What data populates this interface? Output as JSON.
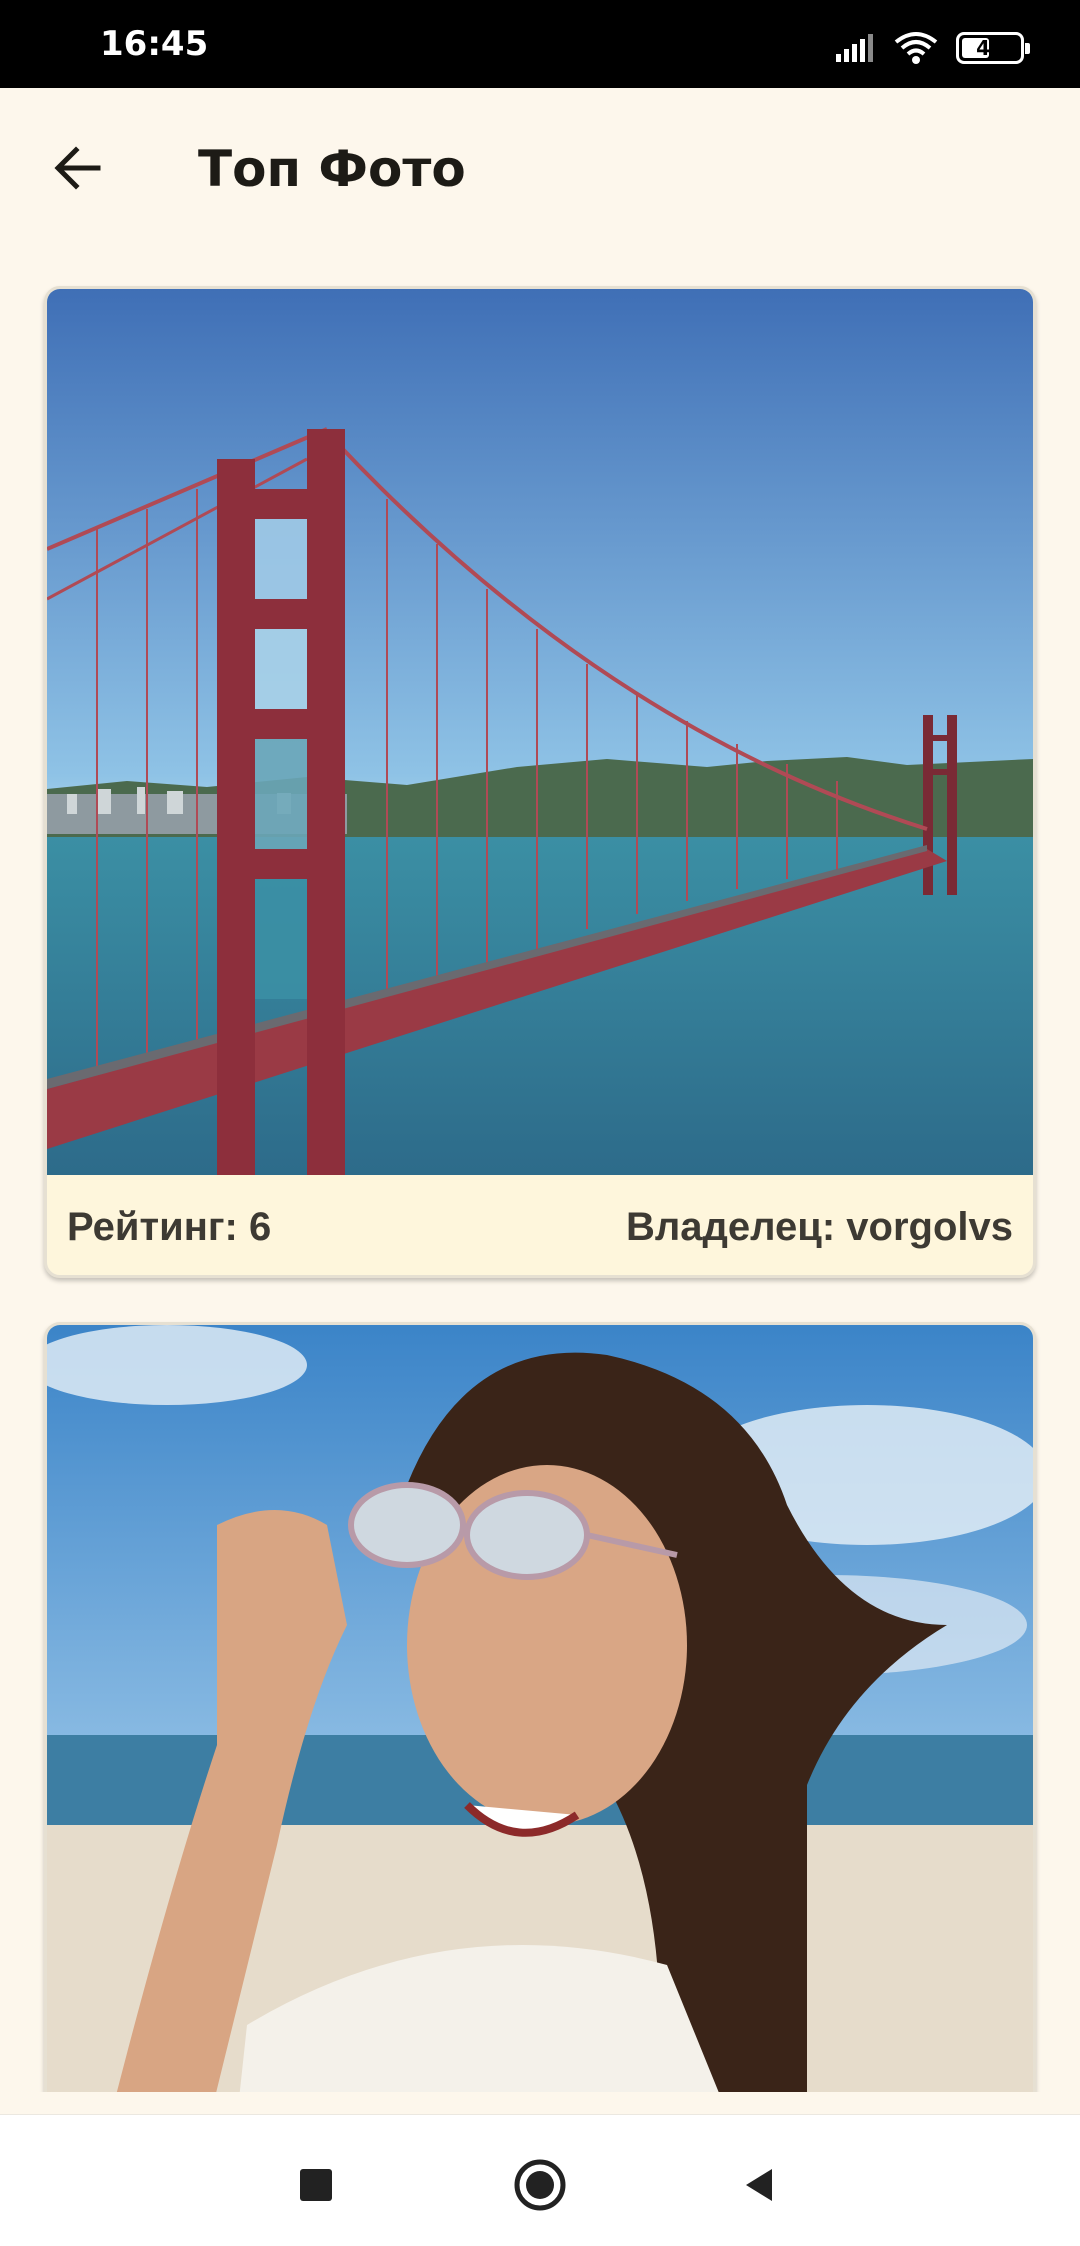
{
  "status_bar": {
    "time": "16:45",
    "battery_level": "48",
    "icons": [
      "signal-icon",
      "wifi-icon",
      "battery-icon"
    ]
  },
  "app_bar": {
    "title": "Топ Фото",
    "back_icon": "arrow-left-icon"
  },
  "photos": [
    {
      "subject": "golden-gate-bridge",
      "rating_label": "Рейтинг: 6",
      "owner_label": "Владелец: vorgolvs"
    },
    {
      "subject": "woman-with-sunglasses-beach",
      "rating_label": "",
      "owner_label": ""
    }
  ],
  "nav_bar": {
    "buttons": [
      "recents-square-icon",
      "home-circle-icon",
      "back-triangle-icon"
    ]
  },
  "colors": {
    "background": "#fdf7ec",
    "card": "#fef6dc",
    "text": "#3d3a33",
    "title": "#1d1b16"
  }
}
